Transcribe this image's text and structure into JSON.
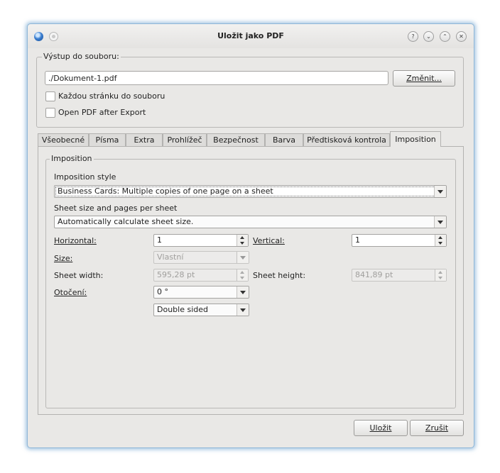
{
  "window": {
    "title": "Uložit jako PDF"
  },
  "titlebar_buttons": [
    "?",
    "⌄",
    "⌃",
    "✕"
  ],
  "output": {
    "group_title": "Výstup do souboru:",
    "file_path": "./Dokument-1.pdf",
    "change_button": "Změnit...",
    "checkbox_each_page": "Každou stránku do souboru",
    "checkbox_open_pdf": "Open PDF after Export"
  },
  "tabs": [
    "Všeobecné",
    "Písma",
    "Extra",
    "Prohlížeč",
    "Bezpečnost",
    "Barva",
    "Předtisková kontrola",
    "Imposition"
  ],
  "active_tab": "Imposition",
  "imposition": {
    "group_title": "Imposition",
    "style_label": "Imposition style",
    "style_value": "Business Cards: Multiple copies of one page on a sheet",
    "sheet_label": "Sheet size and pages per sheet",
    "sheet_value": "Automatically calculate sheet size.",
    "horizontal_label": "Horizontal:",
    "horizontal_value": "1",
    "vertical_label": "Vertical:",
    "vertical_value": "1",
    "size_label": "Size:",
    "size_value": "Vlastní",
    "sheet_width_label": "Sheet width:",
    "sheet_width_value": "595,28 pt",
    "sheet_height_label": "Sheet height:",
    "sheet_height_value": "841,89 pt",
    "rotation_label": "Otočení:",
    "rotation_value": "0 °",
    "sides_value": "Double sided"
  },
  "footer": {
    "save_button": "Uložit",
    "cancel_button": "Zrušit"
  }
}
